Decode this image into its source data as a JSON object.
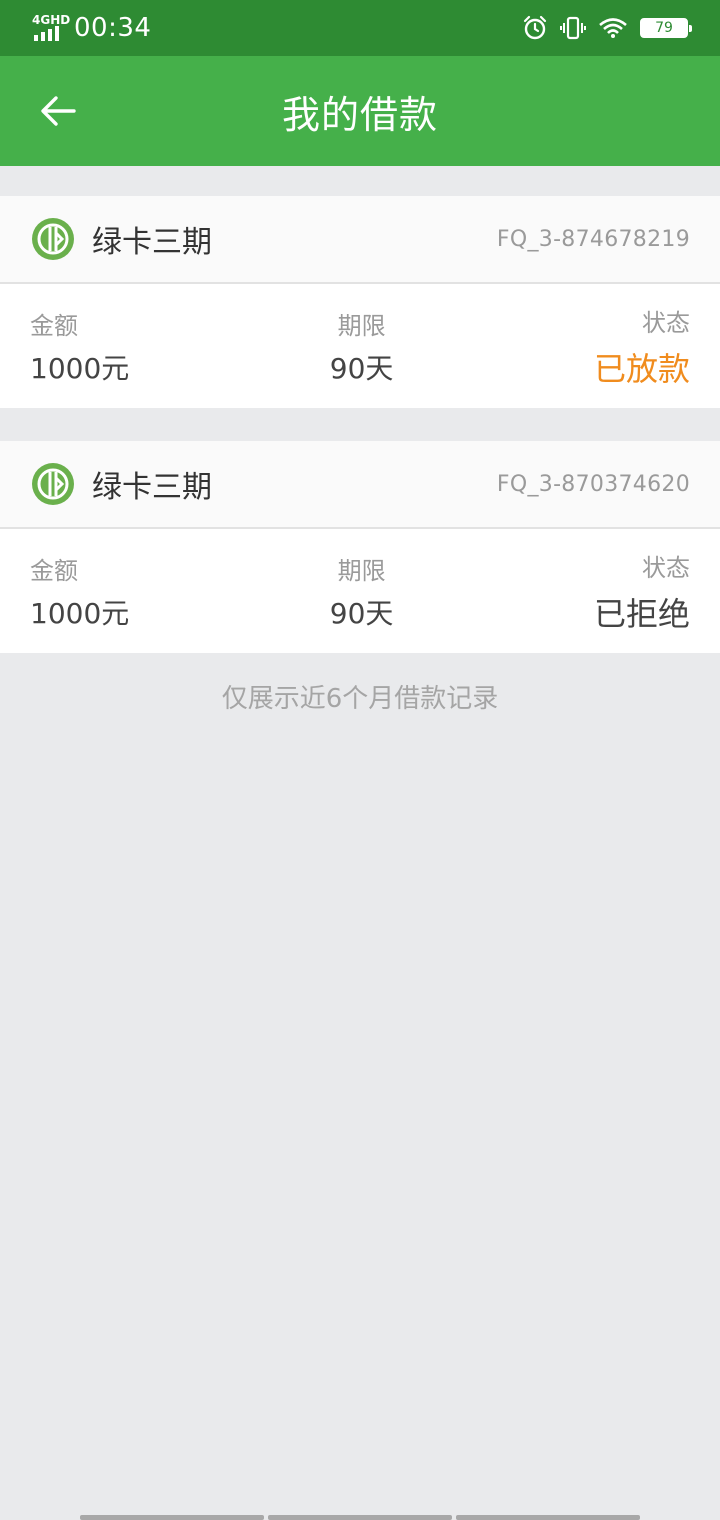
{
  "status_bar": {
    "network": "4GHD",
    "time": "00:34",
    "battery": "79",
    "icons": [
      "alarm-icon",
      "vibrate-icon",
      "wifi-icon",
      "battery-icon"
    ]
  },
  "nav": {
    "title": "我的借款",
    "back_icon": "arrow-left-icon"
  },
  "loans": [
    {
      "product": "绿卡三期",
      "order_no": "FQ_3-874678219",
      "amount_label": "金额",
      "amount": "1000元",
      "term_label": "期限",
      "term": "90天",
      "status_label": "状态",
      "status": "已放款",
      "status_color": "#f08c1e"
    },
    {
      "product": "绿卡三期",
      "order_no": "FQ_3-870374620",
      "amount_label": "金额",
      "amount": "1000元",
      "term_label": "期限",
      "term": "90天",
      "status_label": "状态",
      "status": "已拒绝",
      "status_color": "#444444"
    }
  ],
  "footer_note": "仅展示近6个月借款记录",
  "colors": {
    "status_bar": "#2e8b33",
    "nav_bar": "#45b04a",
    "brand_green": "#6ab04c",
    "background": "#e9eaec"
  }
}
